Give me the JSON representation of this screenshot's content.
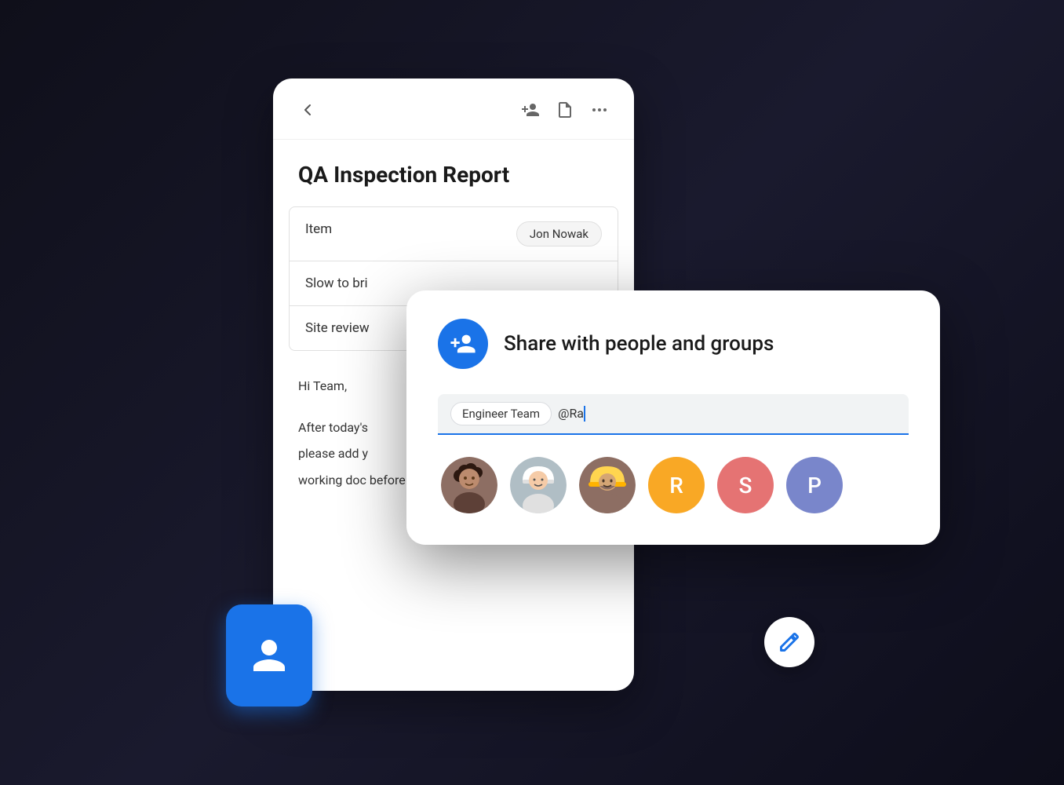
{
  "scene": {
    "background": "dark"
  },
  "doc_card": {
    "title": "QA Inspection Report",
    "back_label": "←",
    "icons": [
      "person-add",
      "description",
      "more-horiz"
    ],
    "table": {
      "rows": [
        {
          "cell1": "Item",
          "cell2": "Jon Nowak"
        },
        {
          "cell1": "Slow to bri",
          "cell2": ""
        },
        {
          "cell1": "Site review",
          "cell2": ""
        }
      ]
    },
    "body": {
      "greeting": "Hi Team,",
      "paragraph1": "After today's",
      "paragraph2": "please add y",
      "paragraph3": "working doc before next week."
    }
  },
  "share_dialog": {
    "title": "Share with people and groups",
    "chip_label": "Engineer Team",
    "input_value": "@Ra",
    "avatars": [
      {
        "type": "photo",
        "alt": "Person 1",
        "color": "#5d4037"
      },
      {
        "type": "photo",
        "alt": "Person 2",
        "color": "#546e7a"
      },
      {
        "type": "photo",
        "alt": "Person 3",
        "color": "#4e342e"
      },
      {
        "type": "letter",
        "letter": "R",
        "color": "#f9a825"
      },
      {
        "type": "letter",
        "letter": "S",
        "color": "#e57373"
      },
      {
        "type": "letter",
        "letter": "P",
        "color": "#7986cb"
      }
    ]
  },
  "fab": {
    "label": "Edit"
  }
}
